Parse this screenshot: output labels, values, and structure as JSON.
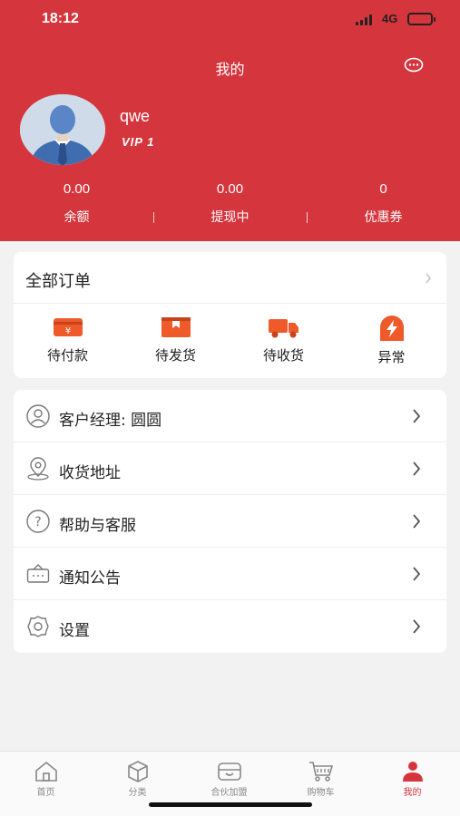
{
  "status_bar": {
    "time": "18:12",
    "network": "4G"
  },
  "header": {
    "title": "我的"
  },
  "profile": {
    "username": "qwe",
    "level": "VIP 1"
  },
  "stats": [
    {
      "value": "0.00",
      "label": "余额"
    },
    {
      "value": "0.00",
      "label": "提现中"
    },
    {
      "value": "0",
      "label": "优惠券"
    }
  ],
  "orders": {
    "title": "全部订单",
    "items": [
      {
        "label": "待付款",
        "icon": "payment-icon"
      },
      {
        "label": "待发货",
        "icon": "package-icon"
      },
      {
        "label": "待收货",
        "icon": "truck-icon"
      },
      {
        "label": "异常",
        "icon": "lightning-icon"
      }
    ]
  },
  "menu": [
    {
      "label": "客户经理: 圆圆",
      "icon": "user-icon"
    },
    {
      "label": "收货地址",
      "icon": "location-icon"
    },
    {
      "label": "帮助与客服",
      "icon": "help-icon"
    },
    {
      "label": "通知公告",
      "icon": "notice-icon"
    },
    {
      "label": "设置",
      "icon": "gear-icon"
    }
  ],
  "tabs": [
    {
      "label": "首页",
      "icon": "home-icon"
    },
    {
      "label": "分类",
      "icon": "category-icon"
    },
    {
      "label": "合伙加盟",
      "icon": "partner-icon"
    },
    {
      "label": "购物车",
      "icon": "cart-icon"
    },
    {
      "label": "我的",
      "icon": "profile-icon",
      "active": true
    }
  ],
  "colors": {
    "brand": "#d5363d",
    "orange": "#ef5a2b"
  }
}
